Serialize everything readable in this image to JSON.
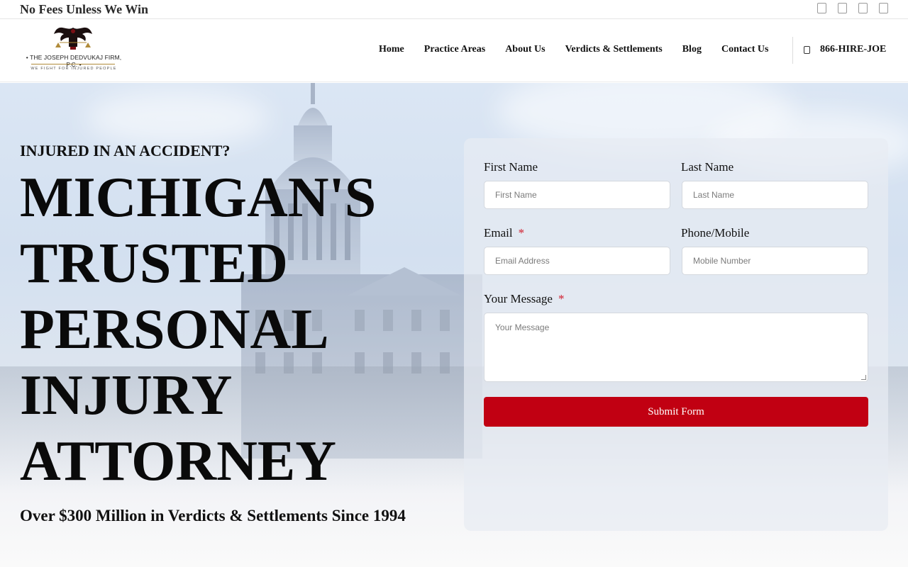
{
  "topbar": {
    "tagline": "No Fees Unless We Win",
    "social_icons": [
      "facebook-icon",
      "twitter-icon",
      "instagram-icon",
      "linkedin-icon"
    ]
  },
  "header": {
    "logo": {
      "firm_name": "• THE JOSEPH DEDVUKAJ FIRM, P.C. •",
      "motto": "WE FIGHT FOR INJURED PEOPLE"
    },
    "nav": [
      "Home",
      "Practice Areas",
      "About Us",
      "Verdicts & Settlements",
      "Blog",
      "Contact Us"
    ],
    "phone": {
      "icon": "phone-icon",
      "label": "866-HIRE-JOE"
    }
  },
  "hero": {
    "eyebrow": "INJURED IN AN ACCIDENT?",
    "headline": [
      "MICHIGAN'S",
      "TRUSTED",
      "PERSONAL",
      "INJURY",
      "ATTORNEY"
    ],
    "subline": "Over $300 Million in Verdicts & Settlements Since 1994"
  },
  "form": {
    "first_name": {
      "label": "First Name",
      "placeholder": "First Name"
    },
    "last_name": {
      "label": "Last Name",
      "placeholder": "Last Name"
    },
    "email": {
      "label": "Email",
      "required_mark": "*",
      "placeholder": "Email Address"
    },
    "phone": {
      "label": "Phone/Mobile",
      "placeholder": "Mobile Number"
    },
    "message": {
      "label": "Your Message",
      "required_mark": "*",
      "placeholder": "Your Message"
    },
    "submit": "Submit Form"
  },
  "colors": {
    "accent_red": "#c10012",
    "required_red": "#d11a2a",
    "text_dark": "#111111"
  }
}
